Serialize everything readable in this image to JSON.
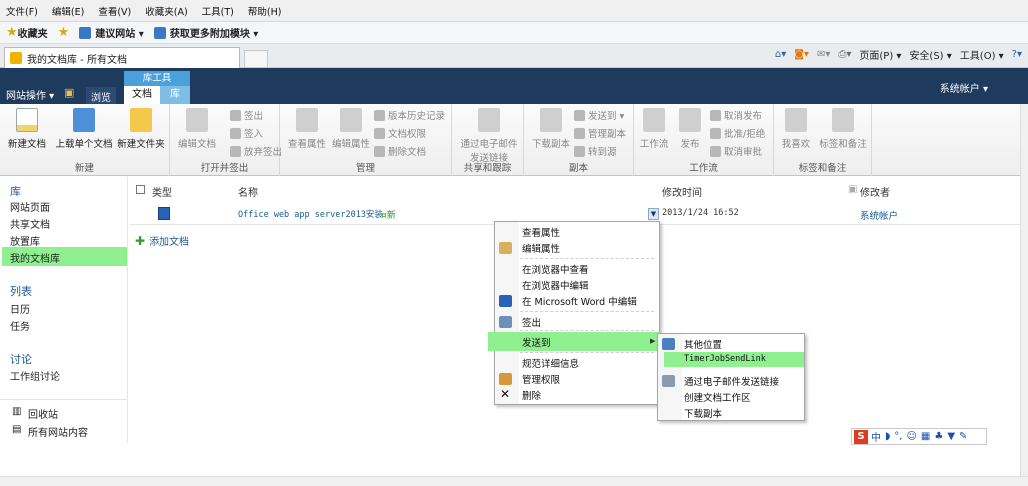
{
  "ie_menu": [
    "文件(F)",
    "编辑(E)",
    "查看(V)",
    "收藏夹(A)",
    "工具(T)",
    "帮助(H)"
  ],
  "favorites": {
    "label": "收藏夹",
    "links": [
      "建议网站 ▾",
      "获取更多附加模块 ▾"
    ]
  },
  "tab": {
    "title": "我的文档库 - 所有文档"
  },
  "command_bar": [
    "页面(P) ▾",
    "安全(S) ▾",
    "工具(O) ▾"
  ],
  "sp_header": {
    "site_actions": "网站操作 ▾",
    "browse": "浏览",
    "library_tools": "库工具",
    "tab_documents": "文档",
    "tab_library": "库",
    "account": "系统帐户 ▾"
  },
  "ribbon": {
    "groups": {
      "new": "新建",
      "open_checkout": "打开并签出",
      "manage": "管理",
      "share_track": "共享和跟踪",
      "copies": "副本",
      "workflows": "工作流",
      "tags": "标签和备注"
    },
    "new_document": "新建文档",
    "upload_document": "上载单个文档",
    "new_folder": "新建文件夹",
    "edit_document": "编辑文档",
    "check_out": "签出",
    "check_in": "签入",
    "discard_checkout": "放弃签出",
    "view_properties": "查看属性",
    "edit_properties": "编辑属性",
    "version_history": "版本历史记录",
    "doc_permissions": "文档权限",
    "delete_document": "删除文档",
    "email_link_line1": "通过电子邮件",
    "email_link_line2": "发送链接",
    "download_copy": "下载副本",
    "send_to": "发送到 ▾",
    "manage_copies": "管理副本",
    "goto_source": "转到源",
    "workflows": "工作流",
    "publish": "发布",
    "unpublish": "取消发布",
    "approve_reject": "批准/拒绝",
    "cancel_approval": "取消审批",
    "i_like_it": "我喜欢",
    "tags_notes": "标签和备注"
  },
  "leftnav": {
    "libraries": "库",
    "site_pages": "网站页面",
    "shared_docs": "共享文档",
    "drop_off": "放置库",
    "my_library": "我的文档库",
    "lists": "列表",
    "calendar": "日历",
    "tasks": "任务",
    "discussions": "讨论",
    "team_discussion": "工作组讨论",
    "recycle_bin": "回收站",
    "all_content": "所有网站内容"
  },
  "list": {
    "col_type": "类型",
    "col_name": "名称",
    "col_modified": "修改时间",
    "col_modified_by": "修改者",
    "row": {
      "name": "Office web app server2013安装",
      "new_tag": "¤新",
      "modified": "2013/1/24 16:52",
      "modified_by": "系统帐户"
    },
    "add_document": "添加文档"
  },
  "context_menu": {
    "view_properties": "查看属性",
    "edit_properties": "编辑属性",
    "view_in_browser": "在浏览器中查看",
    "edit_in_browser": "在浏览器中编辑",
    "edit_in_word": "在 Microsoft Word 中编辑",
    "check_out": "签出",
    "send_to": "发送到",
    "compliance_details": "规范详细信息",
    "manage_permissions": "管理权限",
    "delete": "删除"
  },
  "send_to_menu": {
    "other_location": "其他位置",
    "timer_job": "TimerJobSendLink",
    "email_link": "通过电子邮件发送链接",
    "create_workspace": "创建文档工作区",
    "download_copy": "下载副本"
  },
  "ime": {
    "zh": "中"
  },
  "colors": {
    "sp_header_bg": "#1e3a5c",
    "highlight": "#8ff08f",
    "link": "#1a5a96",
    "library_tools_tab": "#4aa0d8"
  }
}
